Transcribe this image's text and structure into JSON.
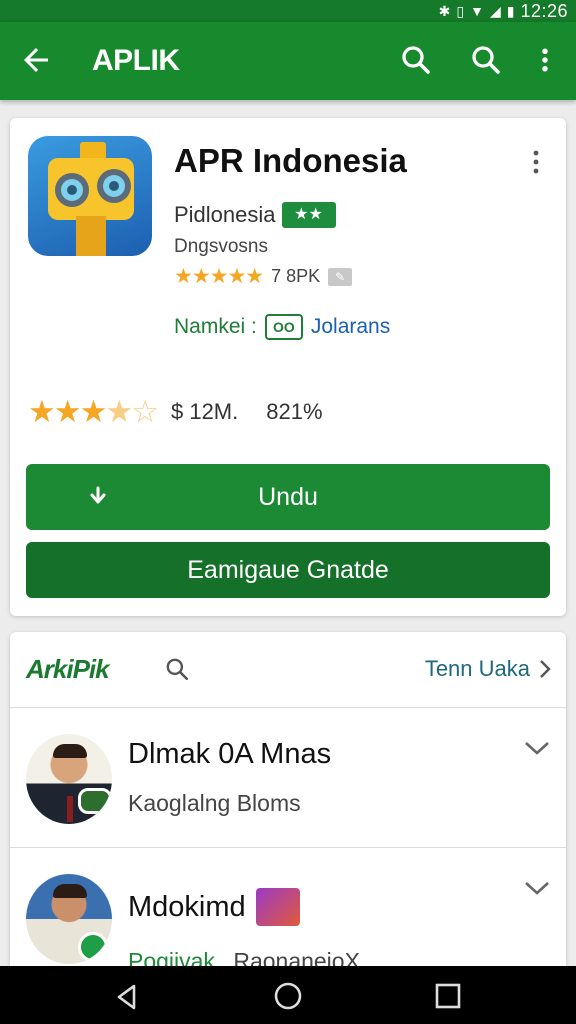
{
  "status": {
    "time": "12:26"
  },
  "appbar": {
    "title": "APLIK",
    "back_icon": "arrow-back-icon",
    "search_icon": "search-icon",
    "more_icon": "more-vert-icon"
  },
  "app": {
    "name": "APR Indonesia",
    "developer": "Pidlonesia",
    "developer_badge": "★★",
    "category": "Dngsvosns",
    "rating_stars": "★★★★★",
    "reviews": "7 8PK",
    "maker_label": "Namkei :",
    "maker_badge": "OO",
    "maker_value": "Jolarans",
    "rating_value": 3.5,
    "price": "$ 12M.",
    "percent": "821%",
    "install_label": "Undu",
    "secondary_label": "Eamigaue Gnatde"
  },
  "section": {
    "brand": "ArkiPik",
    "see_all": "Tenn Uaka",
    "items": [
      {
        "title": "Dlmak 0A Mnas",
        "subtitle": "Kaoglalng Bloms"
      },
      {
        "title": "Mdokimd",
        "subtitle_a": "Pogjivak.",
        "subtitle_b": "RaonaneioX"
      }
    ]
  },
  "colors": {
    "primary": "#188a2e",
    "primary_dark": "#157a2a",
    "star": "#f5a623",
    "link": "#1a5fb4"
  }
}
